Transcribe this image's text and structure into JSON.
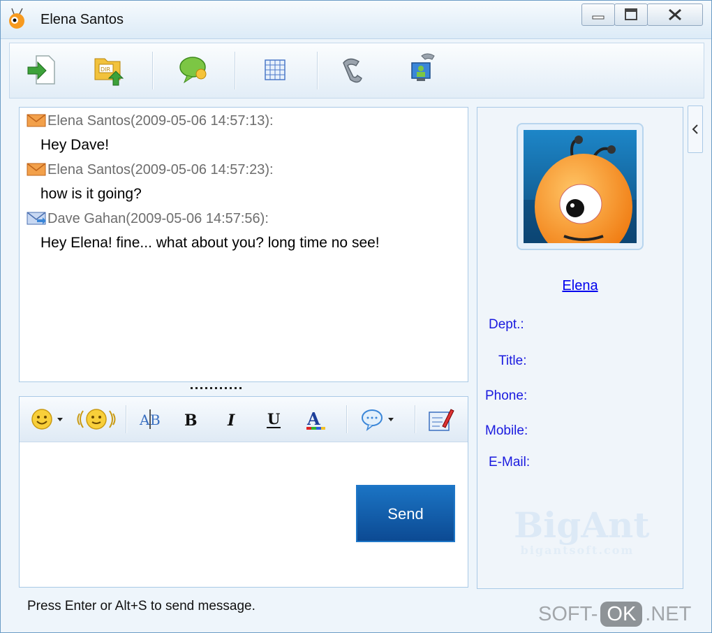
{
  "window": {
    "title": "Elena Santos",
    "controls": [
      "minimize",
      "maximize",
      "close"
    ]
  },
  "toolbar": {
    "buttons": [
      "send-file",
      "send-directory",
      "message",
      "grid",
      "call",
      "video-call"
    ]
  },
  "chat": {
    "messages": [
      {
        "header": "Elena Santos(2009-05-06 14:57:13):",
        "body": "Hey Dave!",
        "icon": "incoming-mail-icon"
      },
      {
        "header": "Elena Santos(2009-05-06 14:57:23):",
        "body": "how is it going?",
        "icon": "incoming-mail-icon"
      },
      {
        "header": "Dave Gahan(2009-05-06 14:57:56):",
        "body": "Hey Elena! fine... what about you? long time no see!",
        "icon": "outgoing-mail-icon"
      }
    ]
  },
  "composer": {
    "send_label": "Send",
    "hint": "Press Enter or Alt+S to send message."
  },
  "profile": {
    "name": "Elena",
    "labels": {
      "dept": "Dept.:",
      "title": "Title:",
      "phone": "Phone:",
      "mobile": "Mobile:",
      "email": "E-Mail:"
    },
    "brand": "BigAnt",
    "brand_site": "bigantsoft.com"
  },
  "watermark": {
    "left": "SOFT-",
    "pill": "OK",
    "right": ".NET"
  },
  "colors": {
    "accent": "#0c4a93",
    "link": "#0000ee",
    "label": "#1a1adf",
    "border": "#a9c9e6"
  }
}
